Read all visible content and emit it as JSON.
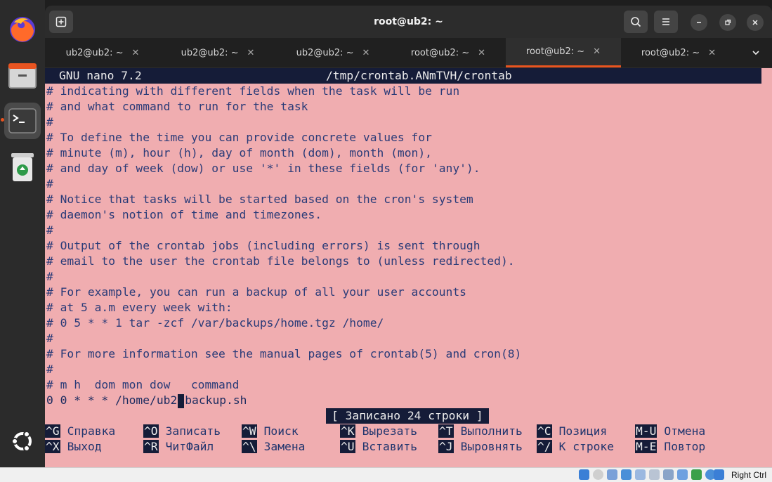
{
  "window": {
    "title": "root@ub2: ~"
  },
  "tabs": [
    {
      "label": "ub2@ub2: ~",
      "active": false
    },
    {
      "label": "ub2@ub2: ~",
      "active": false
    },
    {
      "label": "ub2@ub2: ~",
      "active": false
    },
    {
      "label": "root@ub2: ~",
      "active": false
    },
    {
      "label": "root@ub2: ~",
      "active": true
    },
    {
      "label": "root@ub2: ~",
      "active": false
    }
  ],
  "nano": {
    "version": "GNU nano 7.2",
    "filename": "/tmp/crontab.ANmTVH/crontab",
    "lines": [
      "# indicating with different fields when the task will be run",
      "# and what command to run for the task",
      "#",
      "# To define the time you can provide concrete values for",
      "# minute (m), hour (h), day of month (dom), month (mon),",
      "# and day of week (dow) or use '*' in these fields (for 'any').",
      "#",
      "# Notice that tasks will be started based on the cron's system",
      "# daemon's notion of time and timezones.",
      "#",
      "# Output of the crontab jobs (including errors) is sent through",
      "# email to the user the crontab file belongs to (unless redirected).",
      "#",
      "# For example, you can run a backup of all your user accounts",
      "# at 5 a.m every week with:",
      "# 0 5 * * 1 tar -zcf /var/backups/home.tgz /home/",
      "#",
      "# For more information see the manual pages of crontab(5) and cron(8)",
      "#",
      "# m h  dom mon dow   command"
    ],
    "cursor_line_before": "0 0 * * * /home/ub2",
    "cursor_line_after": "backup.sh",
    "status": "[ Записано 24 строки ]",
    "shortcuts_row1": [
      {
        "key": "^G",
        "label": "Справка"
      },
      {
        "key": "^O",
        "label": "Записать"
      },
      {
        "key": "^W",
        "label": "Поиск"
      },
      {
        "key": "^K",
        "label": "Вырезать"
      },
      {
        "key": "^T",
        "label": "Выполнить"
      },
      {
        "key": "^C",
        "label": "Позиция"
      },
      {
        "key": "M-U",
        "label": "Отмена"
      }
    ],
    "shortcuts_row2": [
      {
        "key": "^X",
        "label": "Выход"
      },
      {
        "key": "^R",
        "label": "ЧитФайл"
      },
      {
        "key": "^\\",
        "label": "Замена"
      },
      {
        "key": "^U",
        "label": "Вставить"
      },
      {
        "key": "^J",
        "label": "Выровнять"
      },
      {
        "key": "^/",
        "label": "К строке"
      },
      {
        "key": "M-E",
        "label": "Повтор"
      }
    ]
  },
  "dock": {
    "apps": [
      "firefox-icon",
      "files-icon",
      "terminal-icon",
      "trash-icon"
    ],
    "bottom": "ubuntu-icon"
  },
  "vbox": {
    "host_key": "Right Ctrl"
  },
  "colors": {
    "accent": "#e95420",
    "terminal_bg": "#f0adb0",
    "nano_bar": "#151c38"
  }
}
